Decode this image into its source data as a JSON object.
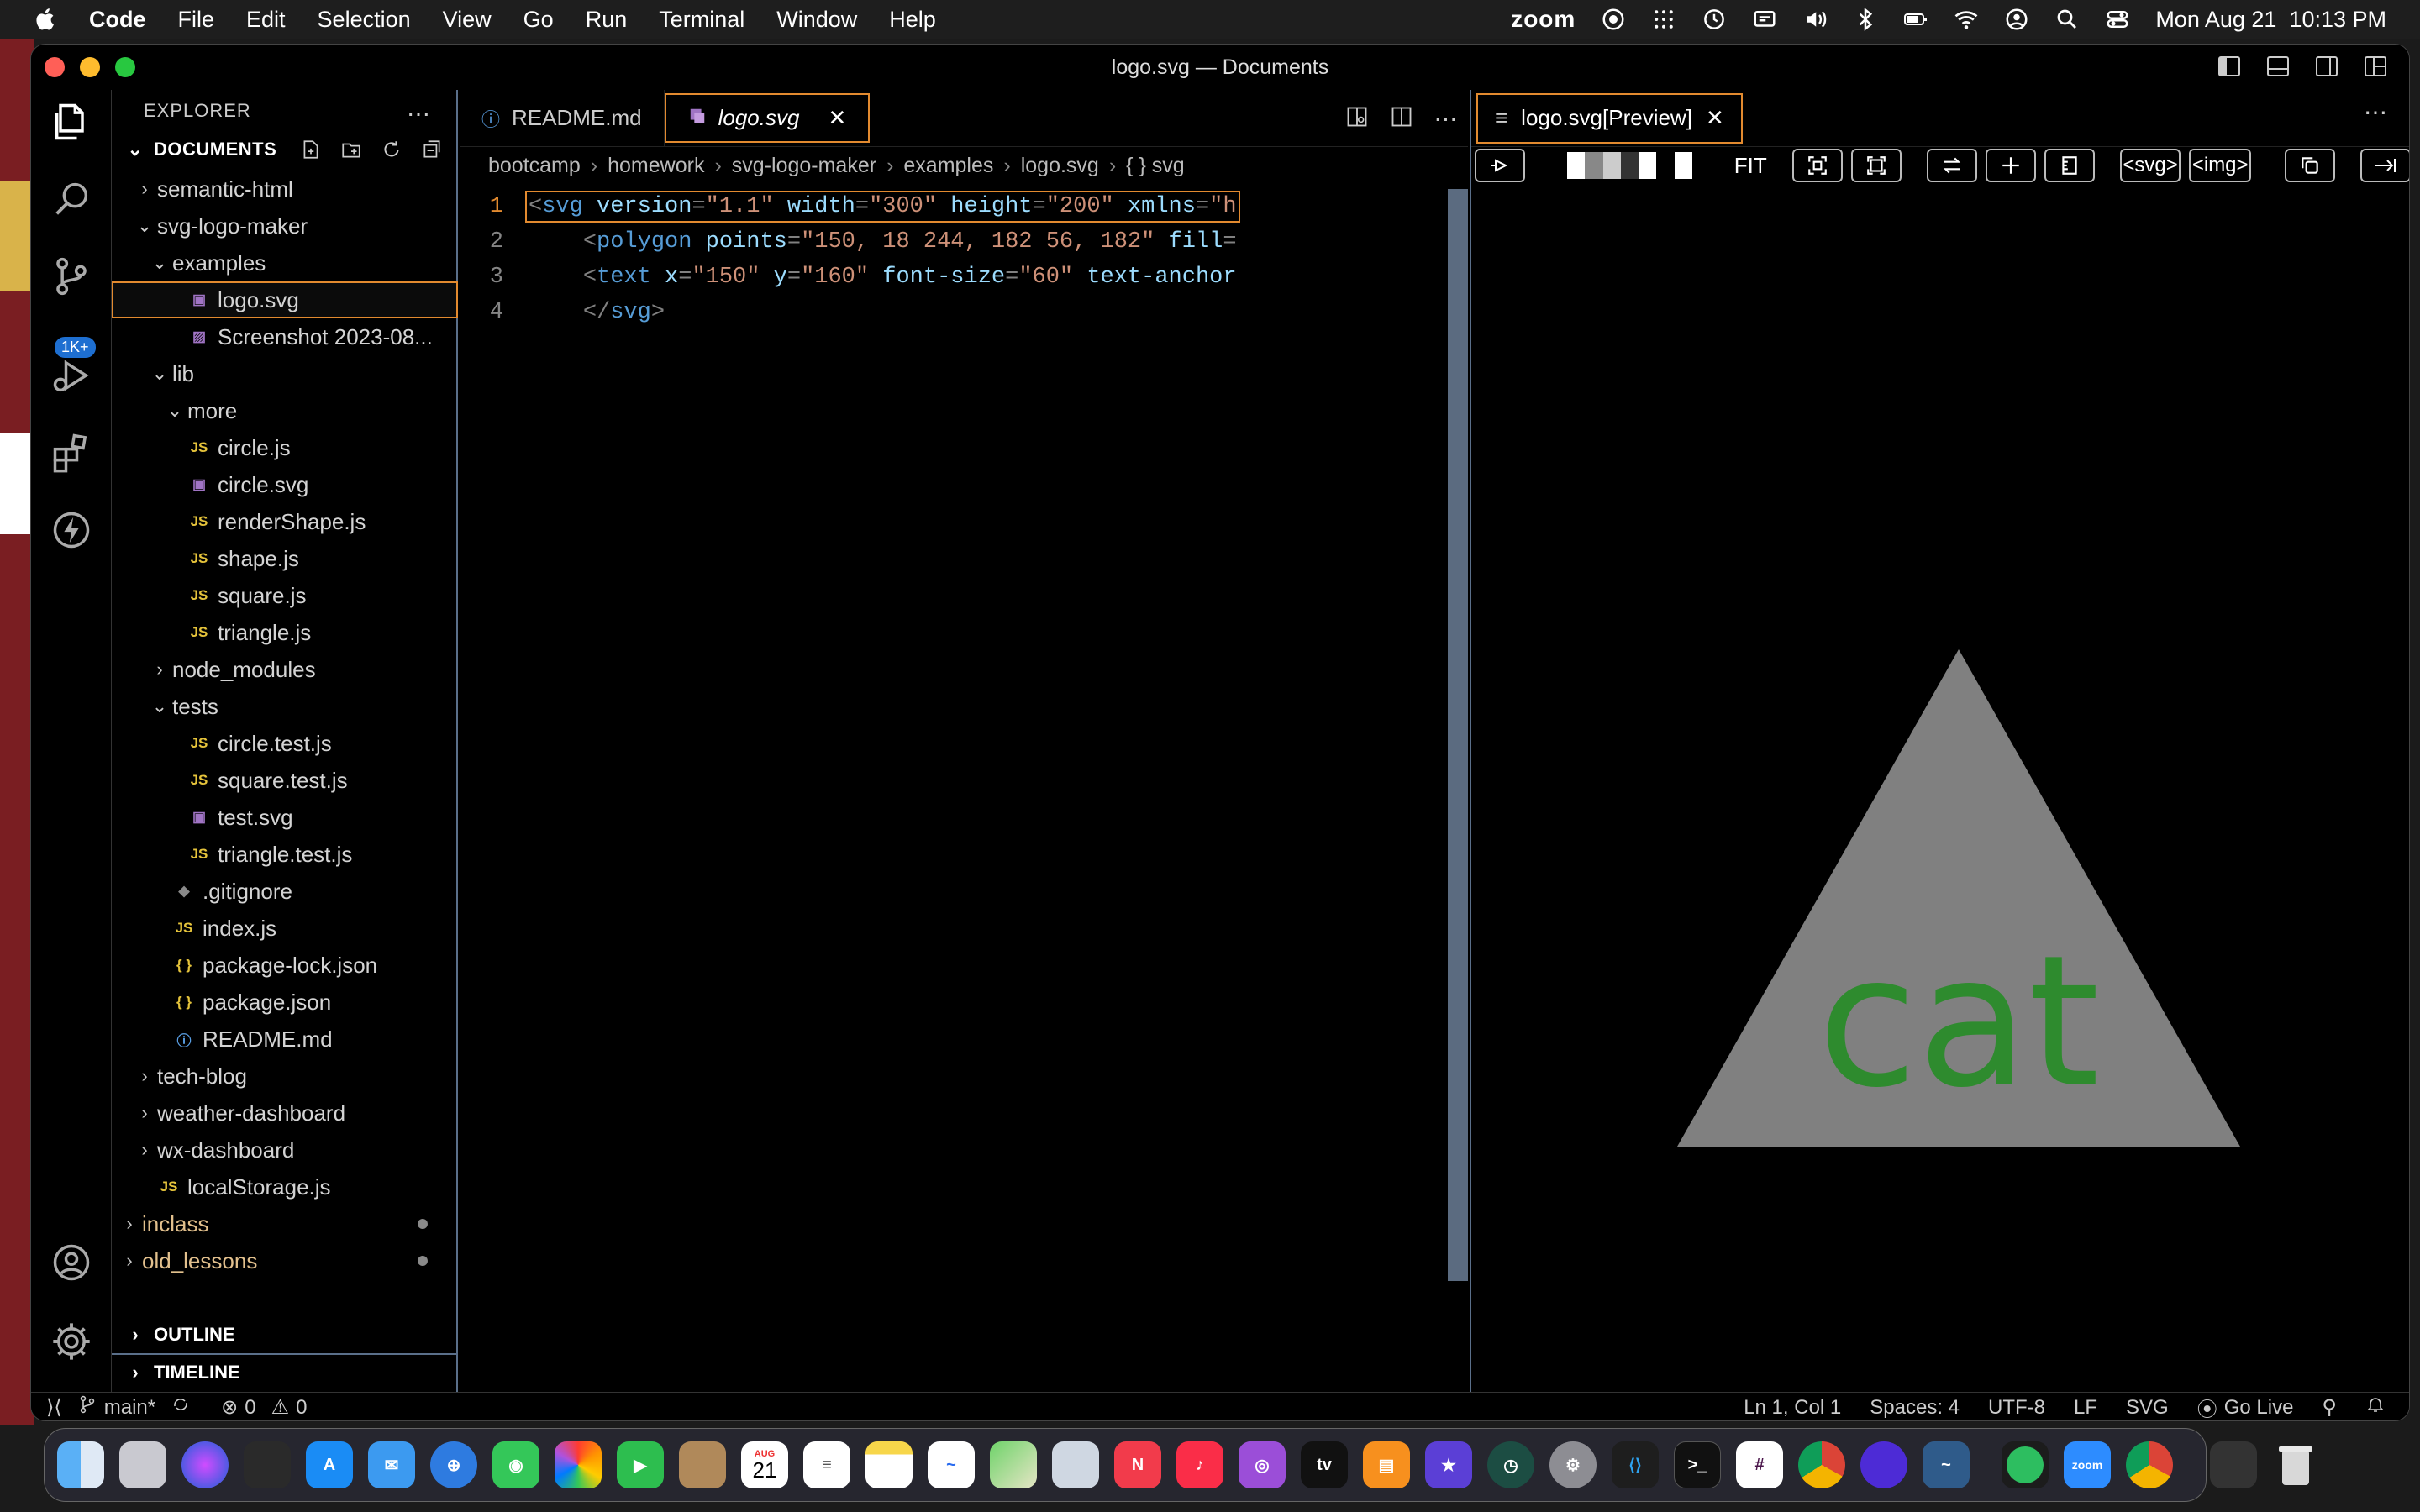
{
  "menubar": {
    "app_name": "Code",
    "items": [
      "File",
      "Edit",
      "Selection",
      "View",
      "Go",
      "Run",
      "Terminal",
      "Window",
      "Help"
    ],
    "zoom_label": "zoom",
    "datetime": "Mon Aug 21  10:13 PM"
  },
  "window": {
    "title": "logo.svg — Documents"
  },
  "activity": {
    "scm_badge": "1K+"
  },
  "explorer": {
    "header": "EXPLORER",
    "section": "DOCUMENTS",
    "tree": [
      {
        "label": "semantic-html",
        "type": "folder-closed",
        "depth": 1
      },
      {
        "label": "svg-logo-maker",
        "type": "folder-open",
        "depth": 1
      },
      {
        "label": "examples",
        "type": "folder-open",
        "depth": 2
      },
      {
        "label": "logo.svg",
        "type": "svg",
        "depth": 3,
        "selected": true
      },
      {
        "label": "Screenshot 2023-08...",
        "type": "img",
        "depth": 3
      },
      {
        "label": "lib",
        "type": "folder-open",
        "depth": 2
      },
      {
        "label": "more",
        "type": "folder-open",
        "depth": 3
      },
      {
        "label": "circle.js",
        "type": "js",
        "depth": 3
      },
      {
        "label": "circle.svg",
        "type": "svg",
        "depth": 3
      },
      {
        "label": "renderShape.js",
        "type": "js",
        "depth": 3
      },
      {
        "label": "shape.js",
        "type": "js",
        "depth": 3
      },
      {
        "label": "square.js",
        "type": "js",
        "depth": 3
      },
      {
        "label": "triangle.js",
        "type": "js",
        "depth": 3
      },
      {
        "label": "node_modules",
        "type": "folder-closed",
        "depth": 2
      },
      {
        "label": "tests",
        "type": "folder-open",
        "depth": 2
      },
      {
        "label": "circle.test.js",
        "type": "js",
        "depth": 3
      },
      {
        "label": "square.test.js",
        "type": "js",
        "depth": 3
      },
      {
        "label": "test.svg",
        "type": "svg",
        "depth": 3
      },
      {
        "label": "triangle.test.js",
        "type": "js",
        "depth": 3
      },
      {
        "label": ".gitignore",
        "type": "gitignore",
        "depth": 2
      },
      {
        "label": "index.js",
        "type": "js",
        "depth": 2
      },
      {
        "label": "package-lock.json",
        "type": "json",
        "depth": 2
      },
      {
        "label": "package.json",
        "type": "json",
        "depth": 2
      },
      {
        "label": "README.md",
        "type": "info",
        "depth": 2
      },
      {
        "label": "tech-blog",
        "type": "folder-closed",
        "depth": 1
      },
      {
        "label": "weather-dashboard",
        "type": "folder-closed",
        "depth": 1
      },
      {
        "label": "wx-dashboard",
        "type": "folder-closed",
        "depth": 1
      },
      {
        "label": "localStorage.js",
        "type": "js",
        "depth": 1
      },
      {
        "label": "inclass",
        "type": "folder-closed",
        "depth": 0,
        "modified": true
      },
      {
        "label": "old_lessons",
        "type": "folder-closed",
        "depth": 0,
        "modified": true
      }
    ],
    "outline": "OUTLINE",
    "timeline": "TIMELINE"
  },
  "editor": {
    "tabs": [
      {
        "label": "README.md",
        "icon": "info"
      },
      {
        "label": "logo.svg",
        "icon": "svg",
        "active": true
      }
    ],
    "breadcrumb": [
      "bootcamp",
      "homework",
      "svg-logo-maker",
      "examples",
      "logo.svg",
      "{ } svg"
    ],
    "lines": [
      {
        "n": "1",
        "tokens": [
          [
            "punc",
            "<"
          ],
          [
            "tag",
            "svg"
          ],
          [
            "txt",
            " "
          ],
          [
            "attr",
            "version"
          ],
          [
            "punc",
            "="
          ],
          [
            "str",
            "\"1.1\""
          ],
          [
            "txt",
            " "
          ],
          [
            "attr",
            "width"
          ],
          [
            "punc",
            "="
          ],
          [
            "str",
            "\"300\""
          ],
          [
            "txt",
            " "
          ],
          [
            "attr",
            "height"
          ],
          [
            "punc",
            "="
          ],
          [
            "str",
            "\"200\""
          ],
          [
            "txt",
            " "
          ],
          [
            "attr",
            "xmlns"
          ],
          [
            "punc",
            "="
          ],
          [
            "str",
            "\"h"
          ]
        ]
      },
      {
        "n": "2",
        "tokens": [
          [
            "txt",
            "    "
          ],
          [
            "punc",
            "<"
          ],
          [
            "tag",
            "polygon"
          ],
          [
            "txt",
            " "
          ],
          [
            "attr",
            "points"
          ],
          [
            "punc",
            "="
          ],
          [
            "str",
            "\"150, 18 244, 182 56, 182\""
          ],
          [
            "txt",
            " "
          ],
          [
            "attr",
            "fill"
          ],
          [
            "punc",
            "="
          ]
        ]
      },
      {
        "n": "3",
        "tokens": [
          [
            "txt",
            "    "
          ],
          [
            "punc",
            "<"
          ],
          [
            "tag",
            "text"
          ],
          [
            "txt",
            " "
          ],
          [
            "attr",
            "x"
          ],
          [
            "punc",
            "="
          ],
          [
            "str",
            "\"150\""
          ],
          [
            "txt",
            " "
          ],
          [
            "attr",
            "y"
          ],
          [
            "punc",
            "="
          ],
          [
            "str",
            "\"160\""
          ],
          [
            "txt",
            " "
          ],
          [
            "attr",
            "font-size"
          ],
          [
            "punc",
            "="
          ],
          [
            "str",
            "\"60\""
          ],
          [
            "txt",
            " "
          ],
          [
            "attr",
            "text-anchor"
          ]
        ]
      },
      {
        "n": "4",
        "tokens": [
          [
            "txt",
            "    "
          ],
          [
            "punc",
            "</"
          ],
          [
            "tag",
            "svg"
          ],
          [
            "punc",
            ">"
          ]
        ]
      }
    ]
  },
  "preview": {
    "tab_label": "logo.svg[Preview]",
    "fit_label": "FIT",
    "svg_btn": "<svg>",
    "img_btn": "<img>",
    "logo_text": "cat",
    "triangle_color": "#808080",
    "text_color": "#2e8b2e"
  },
  "statusbar": {
    "branch": "main*",
    "errors": "0",
    "warnings": "0",
    "position": "Ln 1, Col 1",
    "spaces": "Spaces: 4",
    "encoding": "UTF-8",
    "eol": "LF",
    "language": "SVG",
    "golive": "Go Live"
  },
  "dock": {
    "zoom_label": "zoom",
    "calendar_month": "AUG",
    "calendar_day": "21",
    "tv_label": "tv"
  }
}
